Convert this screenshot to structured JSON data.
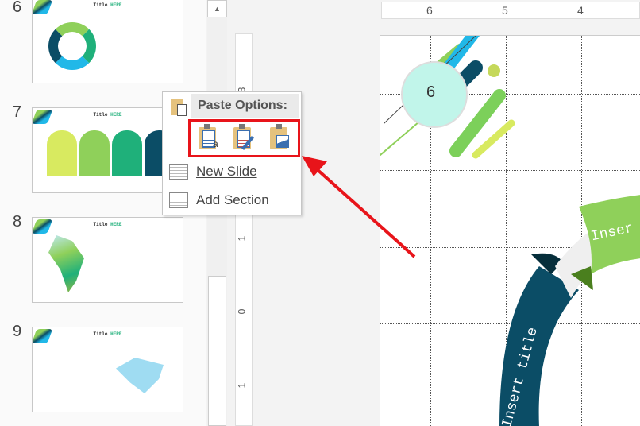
{
  "slides": [
    {
      "number": "6",
      "title": "Title",
      "title_accent": "HERE"
    },
    {
      "number": "7",
      "title": "Title",
      "title_accent": "HERE"
    },
    {
      "number": "8",
      "title": "Title",
      "title_accent": "HERE"
    },
    {
      "number": "9",
      "title": "Title",
      "title_accent": "HERE"
    }
  ],
  "ruler": {
    "h": [
      "6",
      "5",
      "4"
    ],
    "v": [
      "3",
      "1",
      "0",
      "1"
    ]
  },
  "canvas": {
    "badge": "6",
    "ribbon_left": "Insert title",
    "ribbon_right": "Inser"
  },
  "menu": {
    "header": "Paste Options:",
    "paste_buttons": [
      "Use Destination Theme",
      "Keep Source Formatting",
      "Picture"
    ],
    "items": [
      {
        "label": "New Slide"
      },
      {
        "label": "Add Section"
      }
    ]
  },
  "colors": {
    "highlight": "#e8141a",
    "navy": "#0b4d66",
    "green": "#8fd05a"
  }
}
